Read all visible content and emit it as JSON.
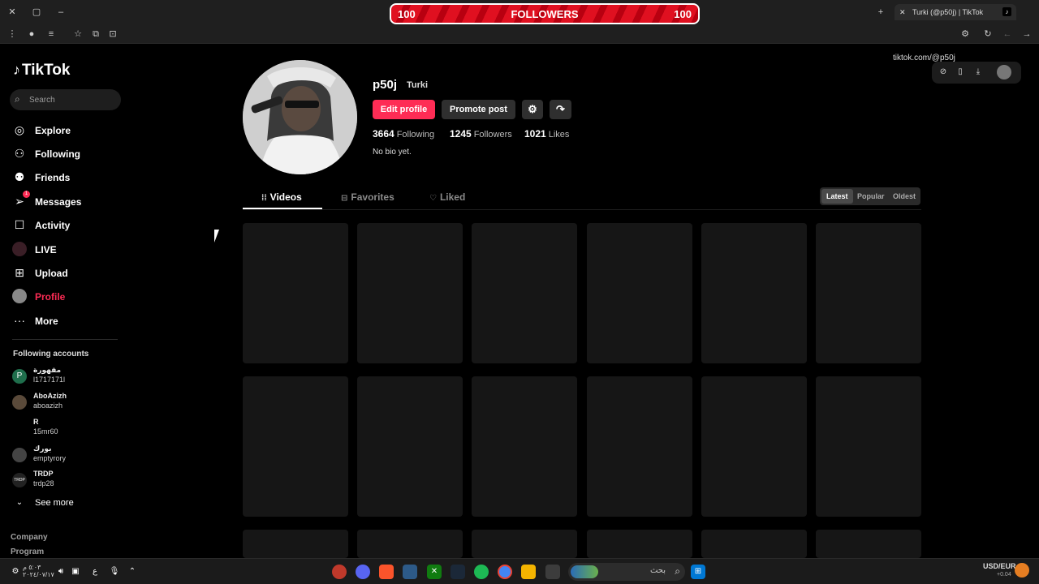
{
  "browser": {
    "tab_title": "Turki (@p50j) | TikTok",
    "url": "tiktok.com/@p50j"
  },
  "banner": {
    "left_count": "100",
    "label": "FOLLOWERS",
    "right_count": "100"
  },
  "sidebar": {
    "logo": "TikTok",
    "search_placeholder": "Search",
    "nav": [
      {
        "label": "Explore"
      },
      {
        "label": "Following"
      },
      {
        "label": "Friends"
      },
      {
        "label": "Messages",
        "badge": "1"
      },
      {
        "label": "Activity"
      },
      {
        "label": "LIVE"
      },
      {
        "label": "Upload"
      },
      {
        "label": "Profile"
      },
      {
        "label": "More"
      }
    ],
    "following_title": "Following accounts",
    "accounts": [
      {
        "name": "مقهورة",
        "handle": "l1717171l",
        "initial": "P"
      },
      {
        "name": "AboAzizh",
        "handle": "aboazizh",
        "initial": ""
      },
      {
        "name": "R",
        "handle": "15mr60",
        "initial": ""
      },
      {
        "name": "بورك",
        "handle": "emptyrory",
        "initial": ""
      },
      {
        "name": "TRDP",
        "handle": "trdp28",
        "initial": "TRDP"
      }
    ],
    "see_more": "See more",
    "footer": [
      "Company",
      "Program"
    ]
  },
  "profile": {
    "username": "p50j",
    "nickname": "Turki",
    "edit_label": "Edit profile",
    "promote_label": "Promote post",
    "following_count": "3664",
    "following_label": "Following",
    "followers_count": "1245",
    "followers_label": "Followers",
    "likes_count": "1021",
    "likes_label": "Likes",
    "bio": "No bio yet."
  },
  "tabs": [
    {
      "label": "Videos",
      "active": true
    },
    {
      "label": "Favorites"
    },
    {
      "label": "Liked"
    }
  ],
  "sort": [
    "Latest",
    "Popular",
    "Oldest"
  ],
  "taskbar": {
    "search_label": "بحث",
    "currency": "USD/EUR",
    "currency_change": "+0.04",
    "time": "٥:٠٣ م",
    "date": "٢٠٢٤/٠٧/١٧"
  },
  "colors": {
    "accent": "#fe2c55",
    "background": "#000000",
    "placeholder_tile": "#161616"
  }
}
